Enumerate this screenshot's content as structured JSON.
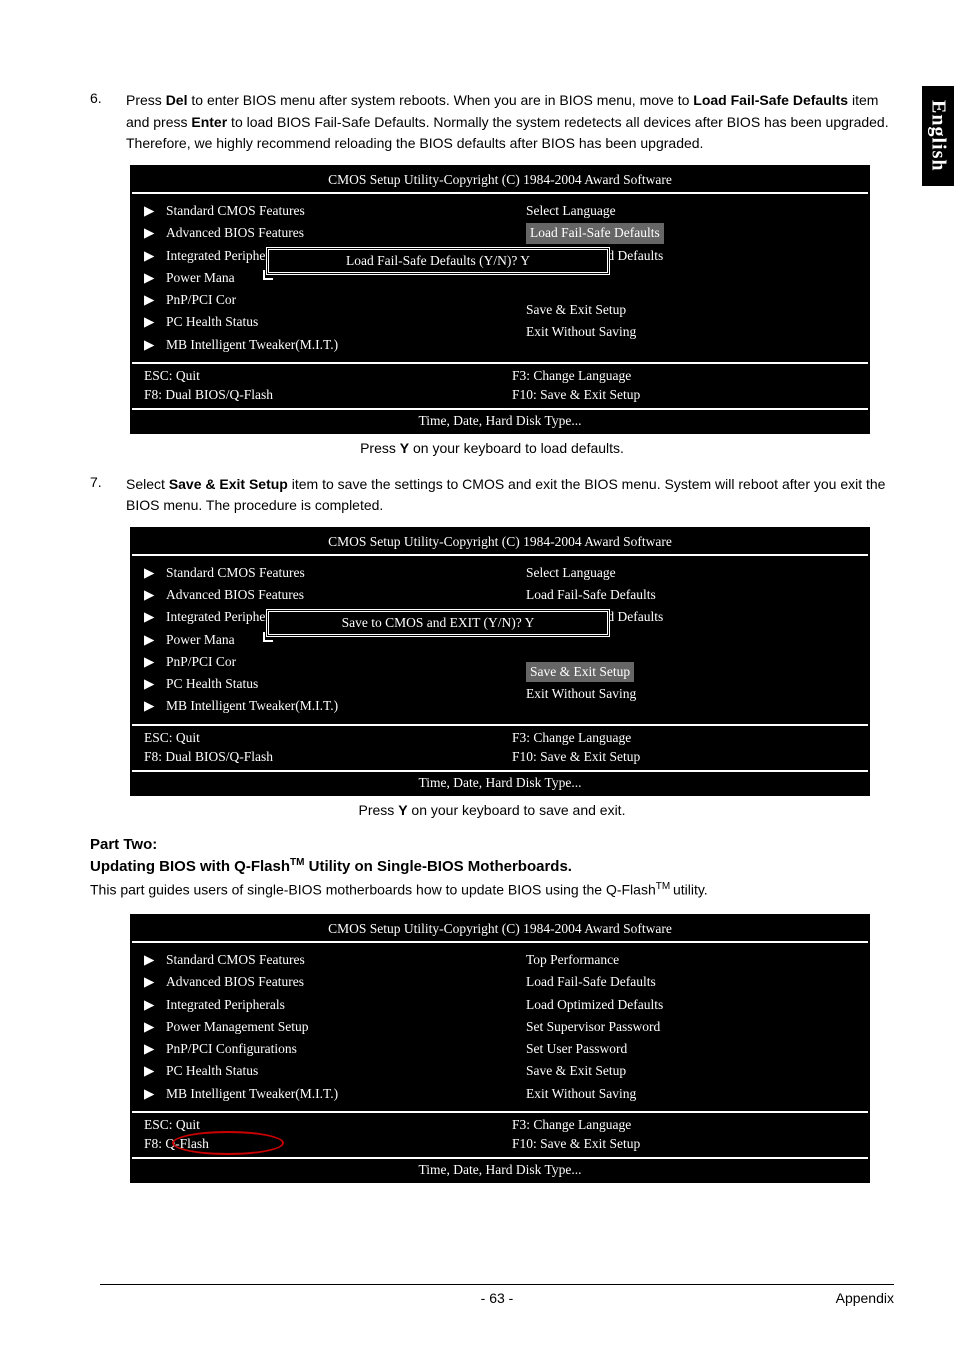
{
  "side_tab": "English",
  "step6": {
    "num": "6.",
    "line1_a": "Press ",
    "line1_b": "Del",
    "line1_c": " to enter BIOS menu after system reboots. When you are in BIOS menu, move to ",
    "line2_a": "Load Fail-Safe Defaults",
    "line2_b": " item and press ",
    "line2_c": "Enter",
    "line2_d": " to load BIOS Fail-Safe Defaults. Normally the system redetects all devices after BIOS has been upgraded. Therefore, we highly recommend reloading the BIOS defaults after BIOS has been upgraded."
  },
  "bios_common": {
    "title": "CMOS Setup Utility-Copyright (C) 1984-2004 Award Software",
    "left_items": [
      "Standard CMOS Features",
      "Advanced BIOS Features",
      "Integrated Peripherals",
      "Power Mana",
      "PnP/PCI Cor",
      "PC Health Status",
      "MB Intelligent Tweaker(M.I.T.)"
    ],
    "left_items_dialog": {
      "power": "Power Mana",
      "pnp": "PnP/PCI Cor"
    },
    "right_items_a": [
      "Select Language",
      "Load Fail-Safe Defaults",
      "Load Optimized Defaults",
      "Save & Exit Setup",
      "Exit Without Saving"
    ],
    "keys": {
      "esc": "ESC: Quit",
      "f8_dual": "F8: Dual BIOS/Q-Flash",
      "f8_single": "F8: Q-Flash",
      "f3": "F3: Change Language",
      "f10": "F10: Save & Exit Setup"
    },
    "help": "Time, Date, Hard Disk Type..."
  },
  "dialog1": "Load Fail-Safe Defaults (Y/N)? Y",
  "caption1_a": "Press ",
  "caption1_b": "Y",
  "caption1_c": " on your keyboard to load defaults.",
  "step7": {
    "num": "7.",
    "line_a": "Select ",
    "line_b": "Save & Exit Setup",
    "line_c": " item to save the settings to CMOS and exit the BIOS menu. System will reboot after you exit the BIOS menu. The procedure is completed."
  },
  "dialog2": "Save to CMOS and EXIT (Y/N)? Y",
  "caption2_a": "Press ",
  "caption2_b": "Y",
  "caption2_c": " on your keyboard to save and exit.",
  "part2": {
    "head": "Part Two:",
    "sub_a": "Updating BIOS with Q-Flash",
    "sub_tm": "TM",
    "sub_b": " Utility on Single-BIOS Motherboards.",
    "desc_a": "This part guides users of single-BIOS motherboards how to update BIOS using the Q-Flash",
    "desc_tm": "TM ",
    "desc_b": "utility."
  },
  "bios3": {
    "left_items": [
      "Standard CMOS Features",
      "Advanced BIOS Features",
      "Integrated Peripherals",
      "Power Management Setup",
      "PnP/PCI Configurations",
      "PC Health Status",
      "MB Intelligent Tweaker(M.I.T.)"
    ],
    "right_items": [
      "Top Performance",
      "Load Fail-Safe Defaults",
      "Load Optimized Defaults",
      "Set Supervisor Password",
      "Set User Password",
      "Save & Exit Setup",
      "Exit Without Saving"
    ],
    "esc": "ESC: Quit"
  },
  "footer": {
    "page": "- 63 -",
    "section": "Appendix"
  }
}
